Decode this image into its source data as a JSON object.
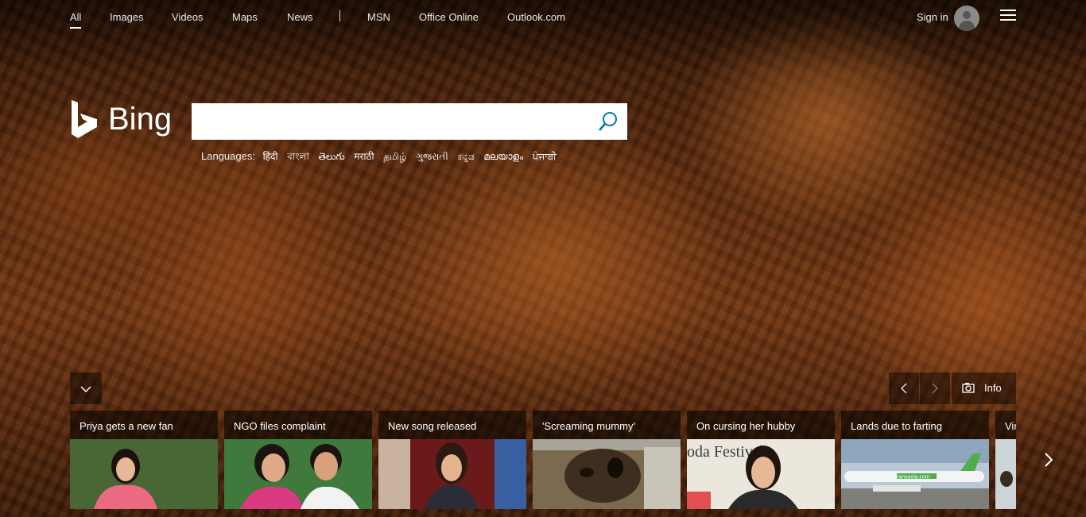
{
  "nav": {
    "items": [
      {
        "label": "All",
        "active": true
      },
      {
        "label": "Images"
      },
      {
        "label": "Videos"
      },
      {
        "label": "Maps"
      },
      {
        "label": "News"
      },
      {
        "label": "MSN"
      },
      {
        "label": "Office Online"
      },
      {
        "label": "Outlook.com"
      }
    ],
    "sign_in": "Sign in"
  },
  "logo": {
    "text": "Bing"
  },
  "search": {
    "value": "",
    "placeholder": ""
  },
  "languages": {
    "label": "Languages:",
    "items": [
      "हिंदी",
      "বাংলা",
      "తెలుగు",
      "मराठी",
      "தமிழ்",
      "ગુજરાતી",
      "ಕನ್ನಡ",
      "മലയാളം",
      "ਪੰਜਾਬੀ"
    ]
  },
  "carousel": {
    "info_label": "Info"
  },
  "news": [
    {
      "title": "Priya gets a new fan"
    },
    {
      "title": "NGO files complaint"
    },
    {
      "title": "New song released"
    },
    {
      "title": "'Screaming mummy'"
    },
    {
      "title": "On cursing her hubby"
    },
    {
      "title": "Lands due to farting"
    },
    {
      "title": "Vir"
    }
  ],
  "card_image_text": {
    "festival": "oda Festival",
    "airline": "transavia.com"
  },
  "colors": {
    "accent_search_icon": "#0078a8",
    "overlay": "rgba(0,0,0,0.55)"
  }
}
